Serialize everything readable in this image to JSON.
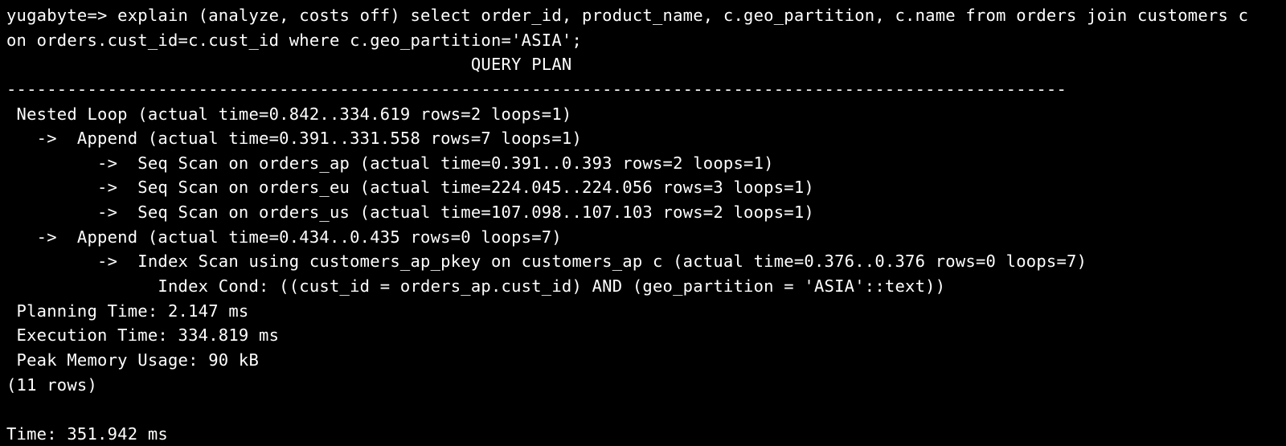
{
  "terminal": {
    "lines": [
      "yugabyte=> explain (analyze, costs off) select order_id, product_name, c.geo_partition, c.name from orders join customers c",
      "on orders.cust_id=c.cust_id where c.geo_partition='ASIA';",
      "                                              QUERY PLAN",
      "---------------------------------------------------------------------------------------------------------",
      " Nested Loop (actual time=0.842..334.619 rows=2 loops=1)",
      "   ->  Append (actual time=0.391..331.558 rows=7 loops=1)",
      "         ->  Seq Scan on orders_ap (actual time=0.391..0.393 rows=2 loops=1)",
      "         ->  Seq Scan on orders_eu (actual time=224.045..224.056 rows=3 loops=1)",
      "         ->  Seq Scan on orders_us (actual time=107.098..107.103 rows=2 loops=1)",
      "   ->  Append (actual time=0.434..0.435 rows=0 loops=7)",
      "         ->  Index Scan using customers_ap_pkey on customers_ap c (actual time=0.376..0.376 rows=0 loops=7)",
      "               Index Cond: ((cust_id = orders_ap.cust_id) AND (geo_partition = 'ASIA'::text))",
      " Planning Time: 2.147 ms",
      " Execution Time: 334.819 ms",
      " Peak Memory Usage: 90 kB",
      "(11 rows)",
      "",
      "Time: 351.942 ms"
    ]
  },
  "colors": {
    "background": "#000000",
    "foreground": "#ffffff"
  }
}
